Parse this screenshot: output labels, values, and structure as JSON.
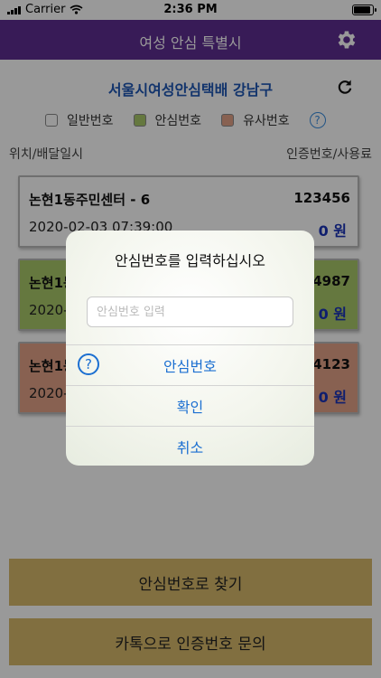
{
  "status_bar": {
    "carrier": "Carrier",
    "time": "2:36 PM",
    "battery_level": 1.0
  },
  "nav": {
    "title": "여성 안심 특별시",
    "settings_icon": "gear-icon"
  },
  "org": {
    "title": "서울시여성안심택배 강남구",
    "refresh_icon": "refresh-icon"
  },
  "legend": {
    "items": [
      {
        "label": "일반번호",
        "color": "#ffffff"
      },
      {
        "label": "안심번호",
        "color": "#a8c86a"
      },
      {
        "label": "유사번호",
        "color": "#e3a287"
      }
    ],
    "help_icon": "?"
  },
  "columns": {
    "left": "위치/배달일시",
    "right": "인증번호/사용료"
  },
  "cards": [
    {
      "name": "논현1동주민센터 - 6",
      "number": "123456",
      "datetime": "2020-02-03 07:39:00",
      "fee": "0 원",
      "color": "#ffffff"
    },
    {
      "name": "논현1동",
      "number": "4987",
      "datetime": "2020-",
      "fee": "0 원",
      "color": "#a8c86a"
    },
    {
      "name": "논현1동",
      "number": "54123",
      "datetime": "2020-",
      "fee": "0 원",
      "color": "#e3a287"
    }
  ],
  "buttons": {
    "find_by_number": "안심번호로 찾기",
    "kakao_inquiry": "카톡으로 인증번호 문의"
  },
  "dialog": {
    "title": "안심번호를 입력하십시오",
    "input_placeholder": "안심번호 입력",
    "input_value": "",
    "help_icon": "?",
    "options": [
      "안심번호",
      "확인",
      "취소"
    ]
  }
}
